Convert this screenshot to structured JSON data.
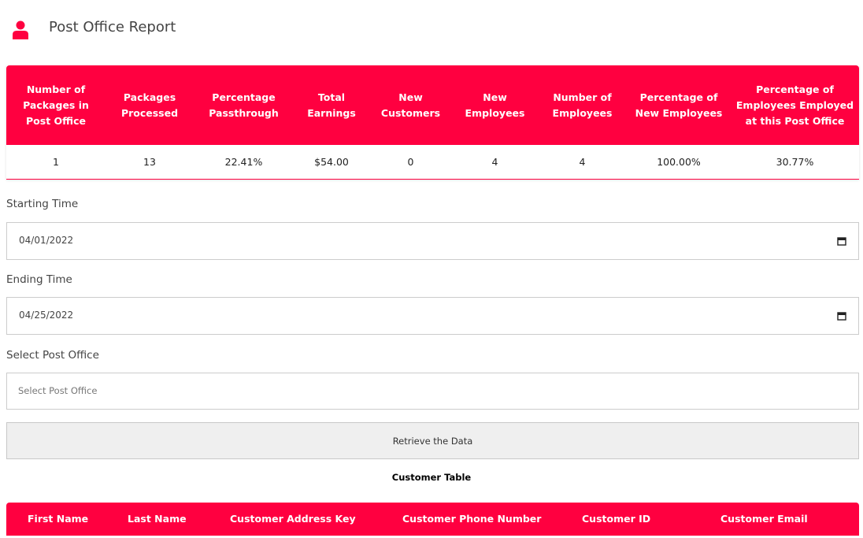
{
  "header": {
    "title": "Post Office Report",
    "icon": "user-icon",
    "accent": "#ff0040"
  },
  "report": {
    "columns": [
      "Number of Packages in Post Office",
      "Packages Processed",
      "Percentage Passthrough",
      "Total Earnings",
      "New Customers",
      "New Employees",
      "Number of Employees",
      "Percentage of New Employees",
      "Percentage of Employees Employed at this Post Office"
    ],
    "values": [
      "1",
      "13",
      "22.41%",
      "$54.00",
      "0",
      "4",
      "4",
      "100.00%",
      "30.77%"
    ]
  },
  "form": {
    "start_label": "Starting Time",
    "start_value": "04/01/2022",
    "end_label": "Ending Time",
    "end_value": "04/25/2022",
    "office_label": "Select Post Office",
    "office_placeholder": "Select Post Office",
    "calendar_icon": "calendar-icon"
  },
  "retrieve_button": "Retrieve the Data",
  "customer_table": {
    "title": "Customer Table",
    "columns": [
      "First Name",
      "Last Name",
      "Customer Address Key",
      "Customer Phone Number",
      "Customer ID",
      "Customer Email"
    ]
  }
}
